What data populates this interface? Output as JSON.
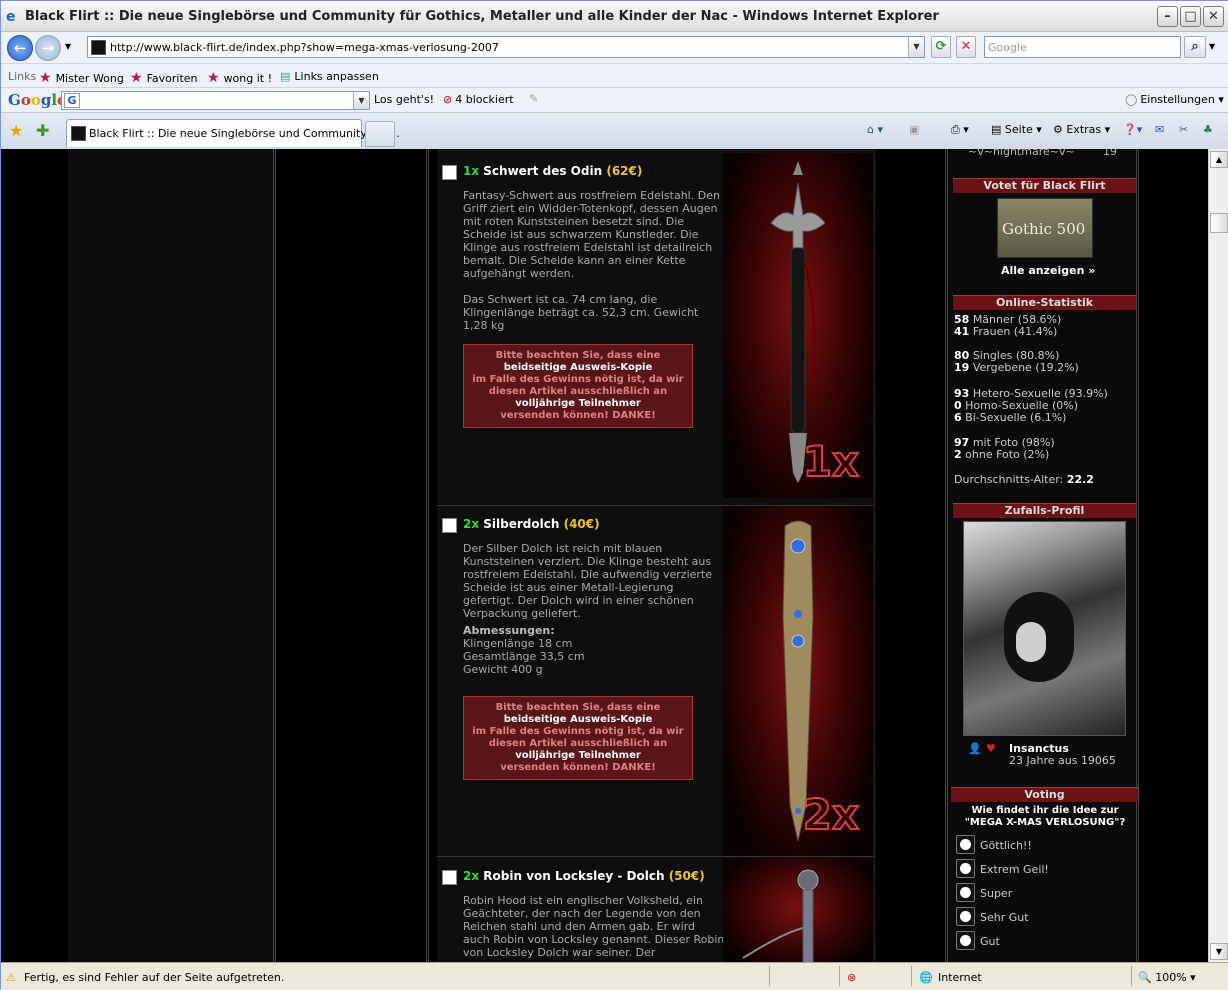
{
  "window": {
    "title": "Black Flirt :: Die neue Singlebörse und Community für Gothics, Metaller und alle Kinder der Nac - Windows Internet Explorer"
  },
  "address": {
    "url": "http://www.black-flirt.de/index.php?show=mega-xmas-verlosung-2007",
    "search_placeholder": "Google"
  },
  "links": {
    "label": "Links",
    "items": [
      "Mister Wong",
      "Favoriten",
      "wong it !",
      "Links anpassen"
    ]
  },
  "google_bar": {
    "logo": "Google",
    "go": "Los geht's!",
    "blocked": "4 blockiert",
    "settings": "Einstellungen"
  },
  "tabs": {
    "active": "Black Flirt :: Die neue Singlebörse und Community für ..."
  },
  "toolbar": {
    "page": "Seite",
    "extras": "Extras"
  },
  "items": [
    {
      "qty": "1x",
      "name": "Schwert des Odin",
      "price": "(62€)",
      "desc": "Fantasy-Schwert aus rostfreiem Edelstahl. Den Griff ziert ein Widder-Totenkopf, dessen Augen mit roten Kunststeinen besetzt sind. Die Scheide ist aus schwarzem Kunstleder. Die Klinge aus rostfreiem Edelstahl ist detailreich bemalt. Die Scheide kann an einer Kette aufgehängt werden.",
      "desc2": "Das Schwert ist ca. 74 cm lang, die Klingenlänge beträgt ca. 52,3 cm. Gewicht 1,28 kg",
      "badge": "1x"
    },
    {
      "qty": "2x",
      "name": "Silberdolch",
      "price": "(40€)",
      "desc": "Der Silber Dolch ist reich mit blauen Kunststeinen verziert. Die Klinge besteht aus rostfreiem Edelstahl. Die aufwendig verzierte Scheide ist aus einer Metall-Legierung gefertigt. Der Dolch wird in einer schönen Verpackung geliefert.",
      "dims_title": "Abmessungen:",
      "dims": [
        "Klingenlänge 18 cm",
        "Gesamtlänge 33,5 cm",
        "Gewicht 400 g"
      ],
      "badge": "2x"
    },
    {
      "qty": "2x",
      "name": "Robin von Locksley - Dolch",
      "price": "(50€)",
      "desc": "Robin Hood ist ein englischer Volksheld, ein Geächteter, der nach der Legende von den Reichen stahl und den Armen gab. Er wird auch Robin von Locksley genannt. Dieser Robin von Locksley Dolch war seiner. Der"
    }
  ],
  "warning": {
    "l1": "Bitte beachten Sie, dass eine",
    "b1": "beidseitige Ausweis-Kopie",
    "l2": "im Falle des Gewinns nötig ist, da wir diesen Artikel ausschließlich an",
    "b2": "volljährige Teilnehmer",
    "l3": "versenden können! DANKE!"
  },
  "sidebar": {
    "top_user": "~v~nightmare~v~",
    "top_num": "19",
    "vote_title": "Votet für Black Flirt",
    "gothic_label": "Gothic 500",
    "show_all": "Alle anzeigen »",
    "stats_title": "Online-Statistik",
    "stats": [
      [
        "58",
        "Männer (58.6%)"
      ],
      [
        "41",
        "Frauen (41.4%)"
      ],
      [
        "80",
        "Singles (80.8%)"
      ],
      [
        "19",
        "Vergebene (19.2%)"
      ],
      [
        "93",
        "Hetero-Sexuelle (93.9%)"
      ],
      [
        "0",
        "Homo-Sexuelle (0%)"
      ],
      [
        "6",
        "Bi-Sexuelle (6.1%)"
      ],
      [
        "97",
        "mit Foto (98%)"
      ],
      [
        "2",
        "ohne Foto (2%)"
      ]
    ],
    "avg_label": "Durchschnitts-Alter:",
    "avg": "22.2",
    "random_title": "Zufalls-Profil",
    "profile_name": "Insanctus",
    "profile_info": "23 Jahre aus 19065",
    "voting_title": "Voting",
    "question": "Wie findet ihr die Idee zur \"MEGA X-MAS VERLOSUNG\"?",
    "options": [
      "Göttlich!!",
      "Extrem Geil!",
      "Super",
      "Sehr Gut",
      "Gut"
    ]
  },
  "status": {
    "text": "Fertig, es sind Fehler auf der Seite aufgetreten.",
    "zone": "Internet",
    "zoom": "100%"
  }
}
